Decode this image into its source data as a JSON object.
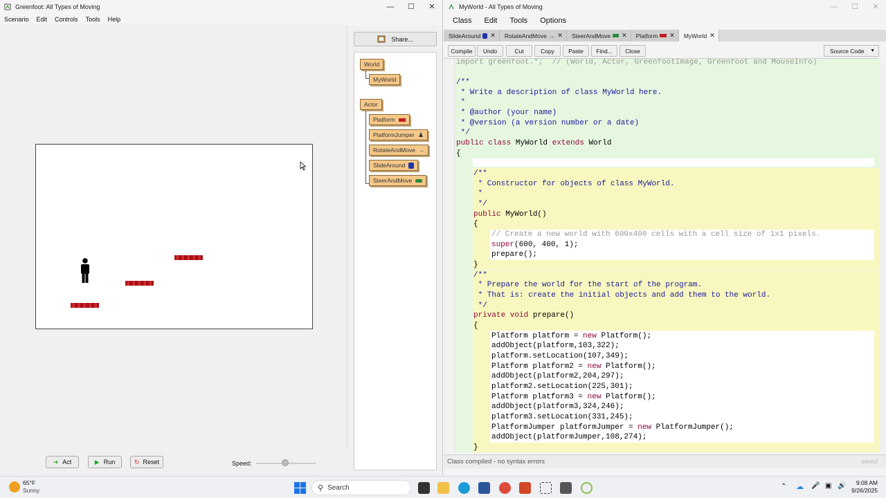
{
  "greenfoot": {
    "title": "Greenfoot: All Types of Moving",
    "menu": [
      "Scenario",
      "Edit",
      "Controls",
      "Tools",
      "Help"
    ],
    "share_label": "Share...",
    "classes": {
      "world": "World",
      "myworld": "MyWorld",
      "actor": "Actor",
      "platform": "Platform",
      "platformjumper": "PlatformJumper",
      "rotateandmove": "RotateAndMove",
      "slidearound": "SlideAround",
      "steerandmove": "SteerAndMove"
    },
    "controls": {
      "act": "Act",
      "run": "Run",
      "reset": "Reset",
      "speed_label": "Speed:",
      "speed_value": 0.5
    }
  },
  "editor": {
    "title": "MyWorld - All Types of Moving",
    "menu": [
      "Class",
      "Edit",
      "Tools",
      "Options"
    ],
    "tabs": [
      "SlideAround",
      "RotateAndMove",
      "SteerAndMove",
      "Platform",
      "MyWorld"
    ],
    "toolbar": [
      "Compile",
      "Undo",
      "Cut",
      "Copy",
      "Paste",
      "Find...",
      "Close"
    ],
    "view_select": "Source Code",
    "code": {
      "import": "import greenfoot.*;  // (World, Actor, GreenfootImage, Greenfoot and MouseInfo)",
      "doc1": "/**",
      "doc2": " * Write a description of class MyWorld here.",
      "doc3": " *",
      "doc4": " * @author (your name)",
      "doc5": " * @version (a version number or a date)",
      "doc6": " */",
      "classdecl": "public class MyWorld extends World",
      "open1": "{",
      "c1": "/**",
      "c2": " * Constructor for objects of class MyWorld.",
      "c3": " *",
      "c4": " */",
      "ctor": "public MyWorld()",
      "open2": "{",
      "comment": "// Create a new world with 600x400 cells with a cell size of 1x1 pixels.",
      "super": "super(600, 400, 1);",
      "prep_call": "prepare();",
      "close2": "}",
      "p1": "/**",
      "p2": " * Prepare the world for the start of the program.",
      "p3": " * That is: create the initial objects and add them to the world.",
      "p4": " */",
      "prepdecl": "private void prepare()",
      "open3": "{",
      "l1": "Platform platform = new Platform();",
      "l2": "addObject(platform,103,322);",
      "l3": "platform.setLocation(107,349);",
      "l4": "Platform platform2 = new Platform();",
      "l5": "addObject(platform2,204,297);",
      "l6": "platform2.setLocation(225,301);",
      "l7": "Platform platform3 = new Platform();",
      "l8": "addObject(platform3,324,246);",
      "l9": "platform3.setLocation(331,245);",
      "l10": "PlatformJumper platformJumper = new PlatformJumper();",
      "l11": "addObject(platformJumper,108,274);",
      "close3": "}"
    },
    "status": "Class compiled - no syntax errors",
    "saved": "saved"
  },
  "taskbar": {
    "weather_temp": "65°F",
    "weather_desc": "Sunny",
    "search": "Search",
    "time": "9:08 AM",
    "date": "9/26/2025"
  },
  "colors": {
    "class_box": "#f5c889",
    "platform": "#c41b22",
    "comment_bg": "#e6f7e0",
    "method_bg": "#f8f7bf"
  }
}
